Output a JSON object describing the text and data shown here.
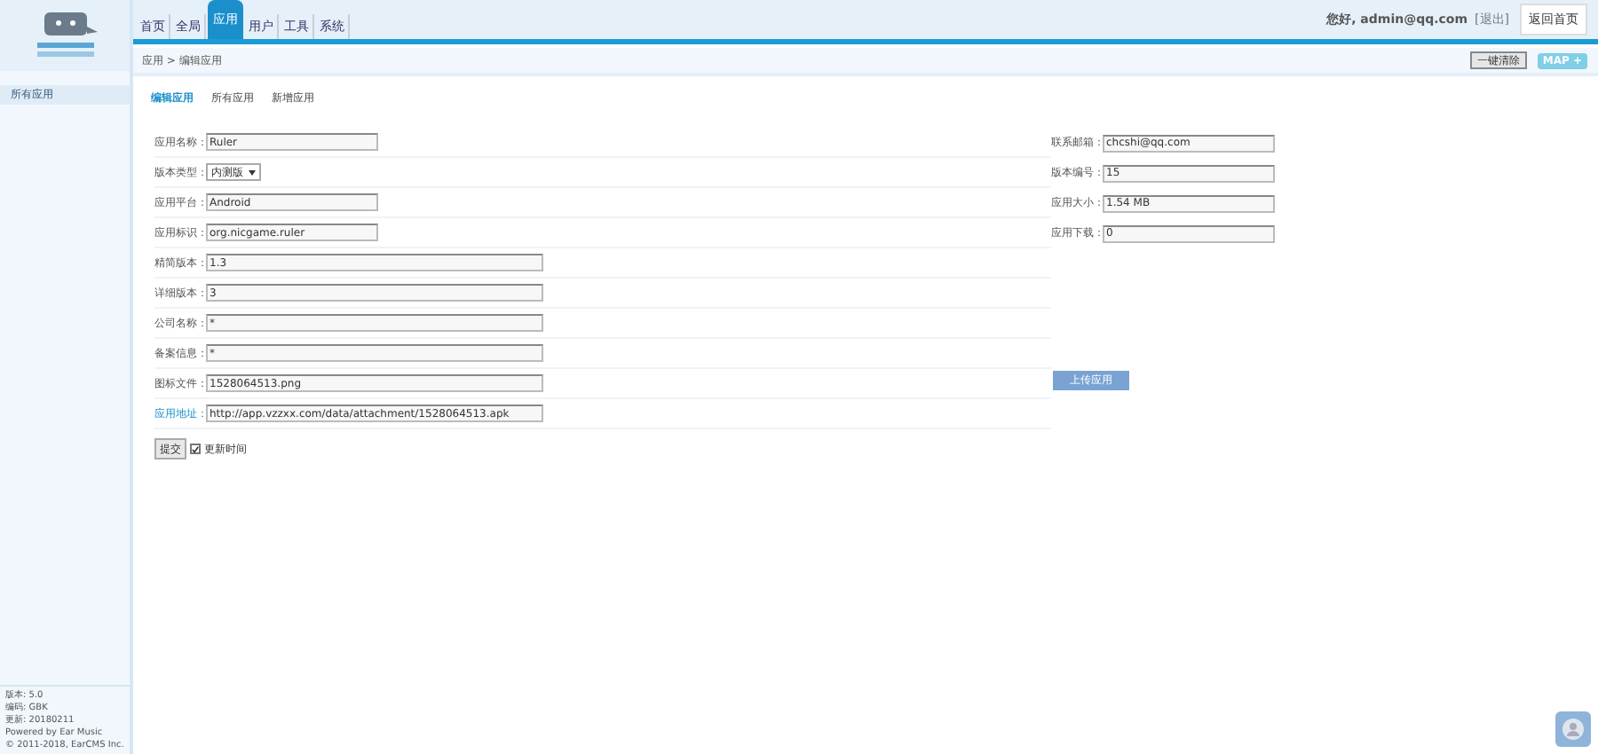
{
  "nav_tabs": [
    {
      "label": "首页",
      "selected": false
    },
    {
      "label": "全局",
      "selected": false
    },
    {
      "label": "应用",
      "selected": true
    },
    {
      "label": "用户",
      "selected": false
    },
    {
      "label": "工具",
      "selected": false
    },
    {
      "label": "系统",
      "selected": false
    }
  ],
  "user": {
    "greeting": "您好, admin@qq.com",
    "logout": "[退出]",
    "home_button": "返回首页"
  },
  "breadcrumb": "应用 > 编辑应用",
  "toolbar_buttons": [
    "一键清除",
    "MAP +"
  ],
  "sidebar": {
    "items": [
      {
        "label": "所有应用",
        "selected": true
      }
    ],
    "footer": [
      "版本: 5.0",
      "编码: GBK",
      "更新: 20180211",
      "Powered by Ear Music",
      "© 2011-2018, EarCMS Inc."
    ]
  },
  "sub_tabs": [
    {
      "label": "编辑应用",
      "selected": true
    },
    {
      "label": "所有应用",
      "selected": false
    },
    {
      "label": "新增应用",
      "selected": false
    }
  ],
  "left_fields": [
    {
      "label": "应用名称：",
      "kind": "short",
      "value": "Ruler"
    },
    {
      "label": "版本类型：",
      "kind": "select",
      "value": "内测版"
    },
    {
      "label": "应用平台：",
      "kind": "short",
      "value": "Android"
    },
    {
      "label": "应用标识：",
      "kind": "short",
      "value": "org.nicgame.ruler"
    },
    {
      "label": "精简版本：",
      "kind": "long",
      "value": "1.3"
    },
    {
      "label": "详细版本：",
      "kind": "long",
      "value": "3"
    },
    {
      "label": "公司名称：",
      "kind": "long",
      "value": "*"
    },
    {
      "label": "备案信息：",
      "kind": "long",
      "value": "*"
    },
    {
      "label": "图标文件：",
      "kind": "long",
      "value": "1528064513.png"
    },
    {
      "label": "应用地址：",
      "kind": "link",
      "value": "http://app.vzzxx.com/data/attachment/1528064513.apk"
    }
  ],
  "right_fields": [
    {
      "label": "联系邮箱：",
      "value": "chcshi@qq.com"
    },
    {
      "label": "版本编号：",
      "value": "15"
    },
    {
      "label": "应用大小：",
      "value": "1.54 MB"
    },
    {
      "label": "应用下载：",
      "value": "0"
    }
  ],
  "upload_button": "上传应用",
  "submit_button": "提交",
  "update_time": {
    "label": "更新时间",
    "checked": true
  }
}
